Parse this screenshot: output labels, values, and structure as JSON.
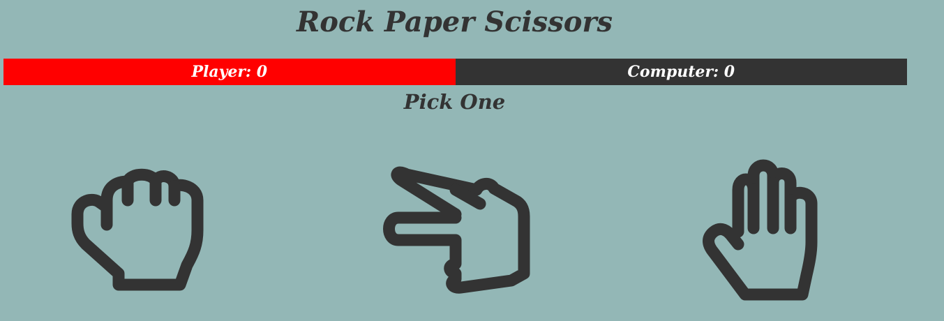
{
  "title": "Rock Paper Scissors",
  "scoreboard": {
    "player_label": "Player: 0",
    "computer_label": "Computer: 0",
    "player_color": "#ff0000",
    "computer_color": "#333333"
  },
  "prompt": "Pick One",
  "choices": [
    {
      "name": "rock",
      "icon": "fist-icon"
    },
    {
      "name": "scissors",
      "icon": "scissors-hand-icon"
    },
    {
      "name": "paper",
      "icon": "open-hand-icon"
    }
  ],
  "colors": {
    "background": "#93b7b6",
    "text": "#333333"
  }
}
